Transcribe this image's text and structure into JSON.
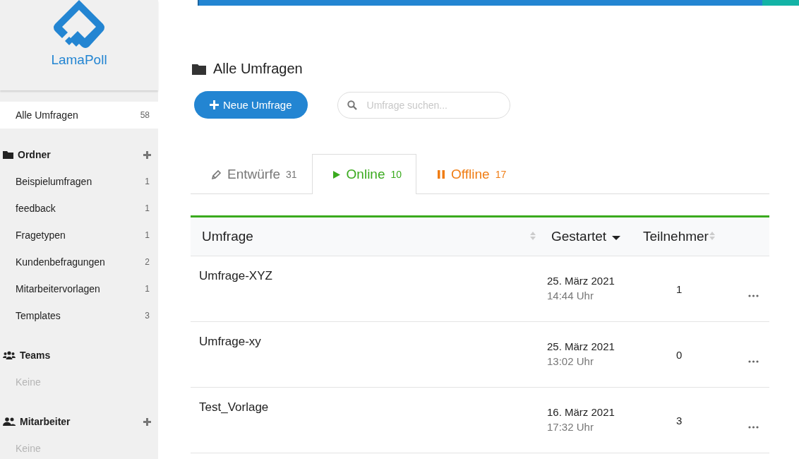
{
  "logo": {
    "text": "LamaPoll"
  },
  "sidebar": {
    "top_item": {
      "label": "Alle Umfragen",
      "count": "58",
      "selected": true
    },
    "sections": [
      {
        "kind": "folders",
        "title": "Ordner",
        "addable": true,
        "items": [
          {
            "label": "Beispielumfragen",
            "count": "1",
            "selected": false
          },
          {
            "label": "feedback",
            "count": "1",
            "selected": false
          },
          {
            "label": "Fragetypen",
            "count": "1",
            "selected": false
          },
          {
            "label": "Kundenbefragungen",
            "count": "2",
            "selected": false
          },
          {
            "label": "Mitarbeitervorlagen",
            "count": "1",
            "selected": false
          },
          {
            "label": "Templates",
            "count": "3",
            "selected": false
          }
        ]
      },
      {
        "kind": "teams",
        "title": "Teams",
        "addable": false,
        "empty_text": "Keine"
      },
      {
        "kind": "people",
        "title": "Mitarbeiter",
        "addable": true,
        "empty_text": "Keine"
      }
    ]
  },
  "page": {
    "title": "Alle Umfragen",
    "new_button": "Neue Umfrage",
    "search": {
      "placeholder": "Umfrage suchen..."
    }
  },
  "tabs": [
    {
      "kind": "draft",
      "label": "Entwürfe",
      "count": "31",
      "selected": false
    },
    {
      "kind": "online",
      "label": "Online",
      "count": "10",
      "selected": true
    },
    {
      "kind": "offline",
      "label": "Offline",
      "count": "17",
      "selected": false
    }
  ],
  "table": {
    "columns": [
      {
        "label": "Umfrage",
        "sorted": false
      },
      {
        "label": "Gestartet",
        "sorted": true
      },
      {
        "label": "Teilnehmer",
        "sorted": false
      }
    ],
    "rows": [
      {
        "name": "Umfrage-XYZ",
        "date": "25. März 2021",
        "time": "14:44 Uhr",
        "participants": "1"
      },
      {
        "name": "Umfrage-xy",
        "date": "25. März 2021",
        "time": "13:02 Uhr",
        "participants": "0"
      },
      {
        "name": "Test_Vorlage",
        "date": "16. März 2021",
        "time": "17:32 Uhr",
        "participants": "3"
      }
    ]
  }
}
